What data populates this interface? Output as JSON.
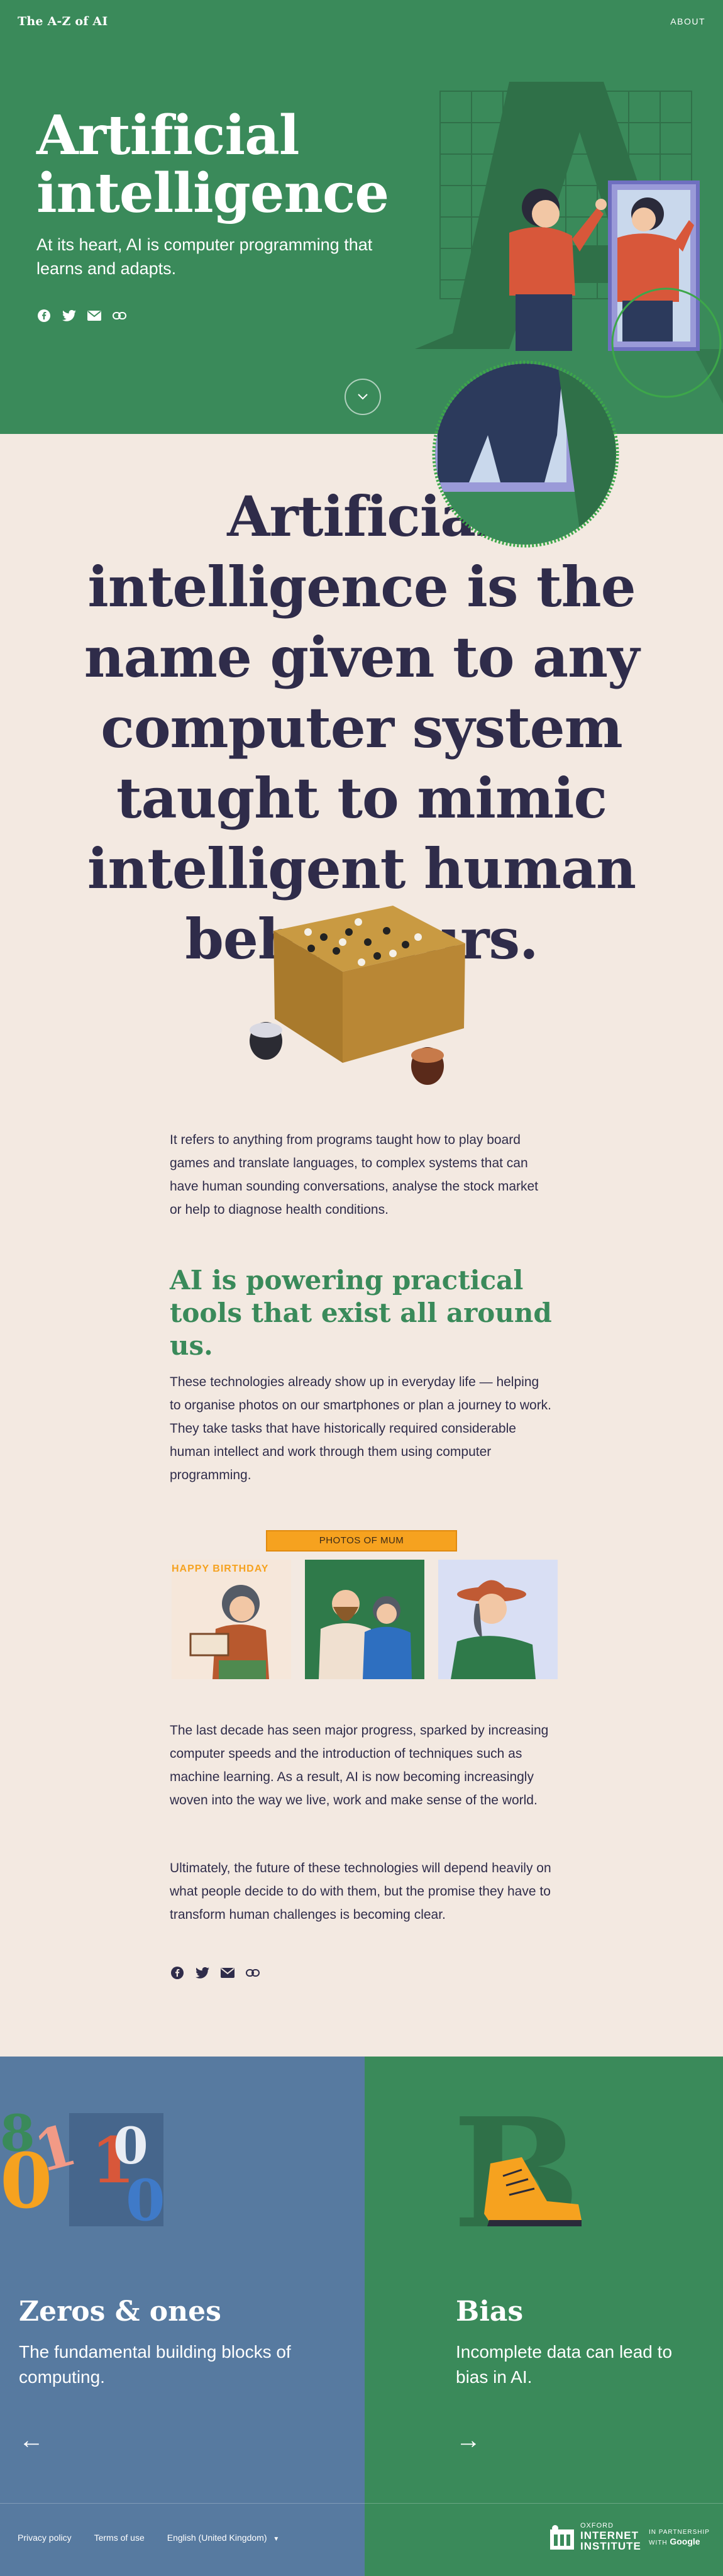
{
  "header": {
    "logo": "The A-Z of AI",
    "about": "ABOUT"
  },
  "hero": {
    "title": "Artificial intelligence",
    "subtitle": "At its heart, AI is computer programming that learns and adapts.",
    "share_icons": [
      "facebook-icon",
      "twitter-icon",
      "email-icon",
      "link-icon"
    ],
    "colors": {
      "background": "#3a8a5a",
      "text": "#ffffff"
    }
  },
  "statement": "Artificial intelligence is the name given to any computer system taught to mimic intelligent human behaviours.",
  "article": {
    "p1": "It refers to anything from programs taught how to play board games and translate languages, to complex systems that can have human sounding conversations, analyse the stock market or help to diagnose health conditions.",
    "subhead": "AI is powering practical tools that exist all around us.",
    "p2": "These technologies already show up in everyday life — helping to organise photos on our smartphones or plan a journey to work. They take tasks that have historically required considerable human intellect and work through them using computer programming.",
    "photos_label": "PHOTOS OF MUM",
    "photo_banner": "HAPPY BIRTHDAY",
    "p3": "The last decade has seen major progress, sparked by increasing computer speeds and the introduction of techniques such as machine learning. As a result, AI is now becoming increasingly woven into the way we live, work and make sense of the world.",
    "p4": "Ultimately, the future of these technologies will depend heavily on what people decide to do with them, but the promise they have to transform human challenges is becoming clear.",
    "colors": {
      "headline": "#2f2c4a",
      "subhead": "#3a8a5a",
      "background": "#f3e9e1"
    }
  },
  "panels": {
    "prev": {
      "title": "Zeros & ones",
      "desc": "The fundamental building blocks of computing.",
      "arrow": "←",
      "color": "#577aa0"
    },
    "next": {
      "title": "Bias",
      "desc": "Incomplete data can lead to bias in AI.",
      "arrow": "→",
      "color": "#3a8a5a"
    }
  },
  "footer": {
    "privacy": "Privacy policy",
    "terms": "Terms of use",
    "language": "English (United Kingdom)",
    "oii_top": "OXFORD",
    "oii_line1": "INTERNET",
    "oii_line2": "INSTITUTE",
    "partner_line1": "IN PARTNERSHIP",
    "partner_line2": "WITH",
    "partner_brand": "Google"
  }
}
